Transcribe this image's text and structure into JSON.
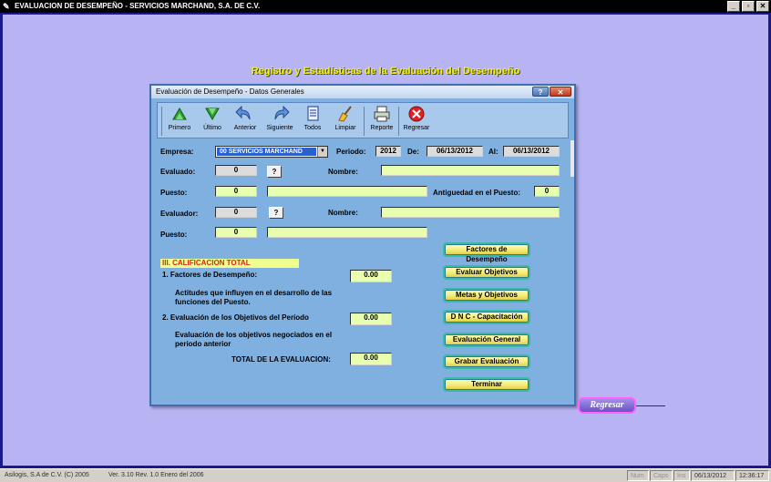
{
  "app": {
    "title": "EVALUACION DE DESEMPEÑO - SERVICIOS MARCHAND, S.A. DE C.V.",
    "minimize": "_",
    "restore": "▫",
    "close": "✕"
  },
  "heading": "Registro y Estadísticas de la Evaluación del Desempeño",
  "dialog": {
    "title": "Evaluación de Desempeño - Datos Generales",
    "help": "?",
    "close": "✕",
    "toolbar": {
      "primero": "Primero",
      "ultimo": "Último",
      "anterior": "Anterior",
      "siguiente": "Siguiente",
      "todos": "Todos",
      "limpiar": "Limpiar",
      "reporte": "Reporte",
      "regresar": "Regresar"
    },
    "empresa_label": "Empresa:",
    "empresa_value": "00  SERVICIOS MARCHAND",
    "periodo_label": "Periodo:",
    "periodo_value": "2012",
    "de_label": "De:",
    "de_value": "06/13/2012",
    "al_label": "Al:",
    "al_value": "06/13/2012",
    "evaluado_label": "Evaluado:",
    "evaluado_value": "0",
    "q1": "?",
    "nombre1_label": "Nombre:",
    "nombre1_value": "",
    "puesto1_label": "Puesto:",
    "puesto1_value": "0",
    "puesto1_desc": "",
    "antiguedad_label": "Antiguedad en el Puesto:",
    "antiguedad_value": "0",
    "evaluador_label": "Evaluador:",
    "evaluador_value": "0",
    "q2": "?",
    "nombre2_label": "Nombre:",
    "nombre2_value": "",
    "puesto2_label": "Puesto:",
    "puesto2_value": "0",
    "puesto2_desc": "",
    "section_title": "III. CALIFICACION TOTAL",
    "factores_label": "1. Factores de Desempeño:",
    "factores_value": "0.00",
    "factores_desc": "Actitudes que influyen en el desarrollo de las funciones del Puesto.",
    "objetivos_label": "2. Evaluación de los Objetivos del Período",
    "objetivos_value": "0.00",
    "objetivos_desc": "Evaluación de los objetivos negociados en el periodo anterior",
    "total_label": "TOTAL DE LA EVALUACION:",
    "total_value": "0.00",
    "actions": {
      "factores": "Factores de Desempeño",
      "evaluar": "Evaluar Objetivos",
      "metas": "Metas y Objetivos",
      "dnc": "D N C - Capacitación",
      "general": "Evaluación General",
      "grabar": "Grabar Evaluación",
      "terminar": "Terminar"
    }
  },
  "regresar": "Regresar",
  "status": {
    "company": "Asilogis, S.A de C.V. (C) 2005",
    "version": "Ver. 3.10 Rev. 1.0   Enero del 2006",
    "num": "Num",
    "caps": "Caps",
    "ins": "Ins",
    "date": "06/13/2012",
    "time": "12:36:17"
  }
}
